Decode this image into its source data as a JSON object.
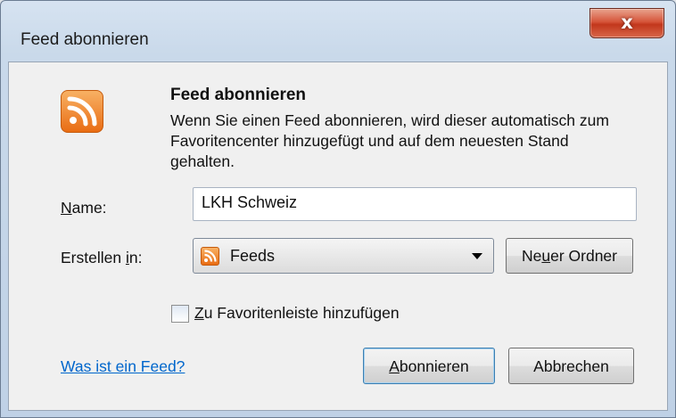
{
  "window": {
    "title": "Feed abonnieren",
    "close_glyph": "x"
  },
  "content": {
    "icon": "rss-feed-icon",
    "heading": "Feed abonnieren",
    "description": "Wenn Sie einen Feed abonnieren, wird dieser automatisch zum Favoritencenter hinzugefügt und auf dem neuesten Stand gehalten."
  },
  "form": {
    "name_label": {
      "accel": "N",
      "rest": "ame:"
    },
    "name_value": "LKH Schweiz",
    "folder_label": {
      "pre": "Erstellen ",
      "accel": "i",
      "rest": "n:"
    },
    "folder_selected": "Feeds",
    "folder_icon": "rss-folder-icon",
    "new_folder_button": {
      "pre": "Ne",
      "accel": "u",
      "rest": "er Ordner"
    },
    "favorites_checkbox": {
      "accel": "Z",
      "rest": "u Favoritenleiste hinzufügen",
      "checked": false
    }
  },
  "footer": {
    "help_link": "Was ist ein Feed?",
    "subscribe_button": {
      "accel": "A",
      "rest": "bonnieren"
    },
    "cancel_button": "Abbrechen"
  },
  "colors": {
    "accent_rss": "#e96d14",
    "link": "#0066cc",
    "close_red": "#c2371c"
  }
}
